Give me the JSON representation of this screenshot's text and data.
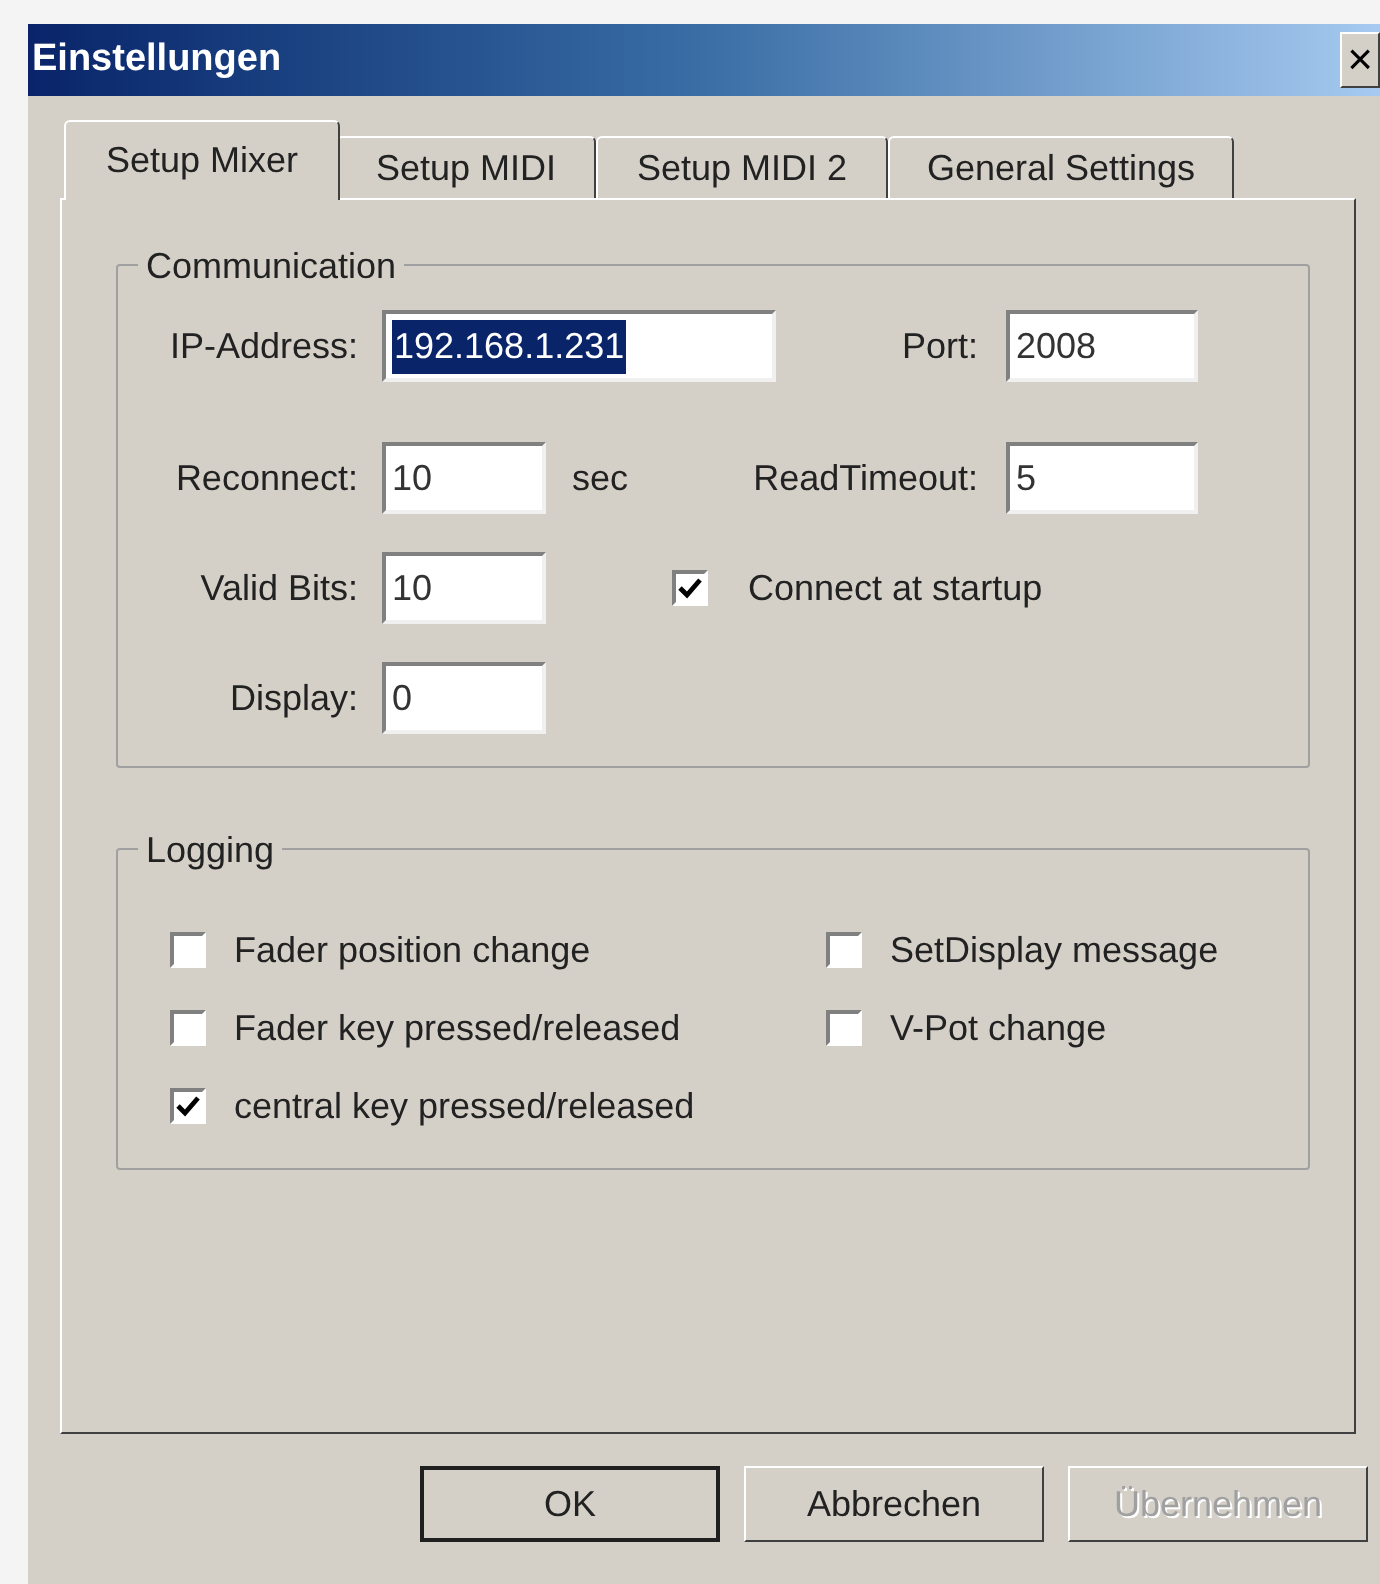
{
  "window": {
    "title": "Einstellungen",
    "close": "×"
  },
  "tabs": [
    {
      "label": "Setup Mixer",
      "selected": true
    },
    {
      "label": "Setup MIDI",
      "selected": false
    },
    {
      "label": "Setup MIDI 2",
      "selected": false
    },
    {
      "label": "General Settings",
      "selected": false
    }
  ],
  "communication": {
    "title": "Communication",
    "ip_address": {
      "label": "IP-Address:",
      "value": "192.168.1.231",
      "highlighted": true
    },
    "port": {
      "label": "Port:",
      "value": "2008",
      "highlighted": false
    },
    "reconnect": {
      "label": "Reconnect:",
      "value": "10",
      "unit": "sec",
      "highlighted": false
    },
    "read_timeout": {
      "label": "ReadTimeout:",
      "value": "5",
      "highlighted": false
    },
    "valid_bits": {
      "label": "Valid Bits:",
      "value": "10",
      "highlighted": false
    },
    "connect_at_startup": {
      "label": "Connect at startup",
      "checked": true
    },
    "display": {
      "label": "Display:",
      "value": "0",
      "highlighted": false
    }
  },
  "logging": {
    "title": "Logging",
    "options": [
      {
        "label": "Fader position change",
        "checked": false
      },
      {
        "label": "SetDisplay message",
        "checked": false
      },
      {
        "label": "Fader key pressed/released",
        "checked": false
      },
      {
        "label": "V-Pot change",
        "checked": false
      },
      {
        "label": "central key pressed/released",
        "checked": true
      }
    ]
  },
  "buttons": [
    {
      "label": "OK",
      "default": true,
      "disabled": false
    },
    {
      "label": "Abbrechen",
      "default": false,
      "disabled": false
    },
    {
      "label": "Übernehmen",
      "default": false,
      "disabled": true
    }
  ]
}
